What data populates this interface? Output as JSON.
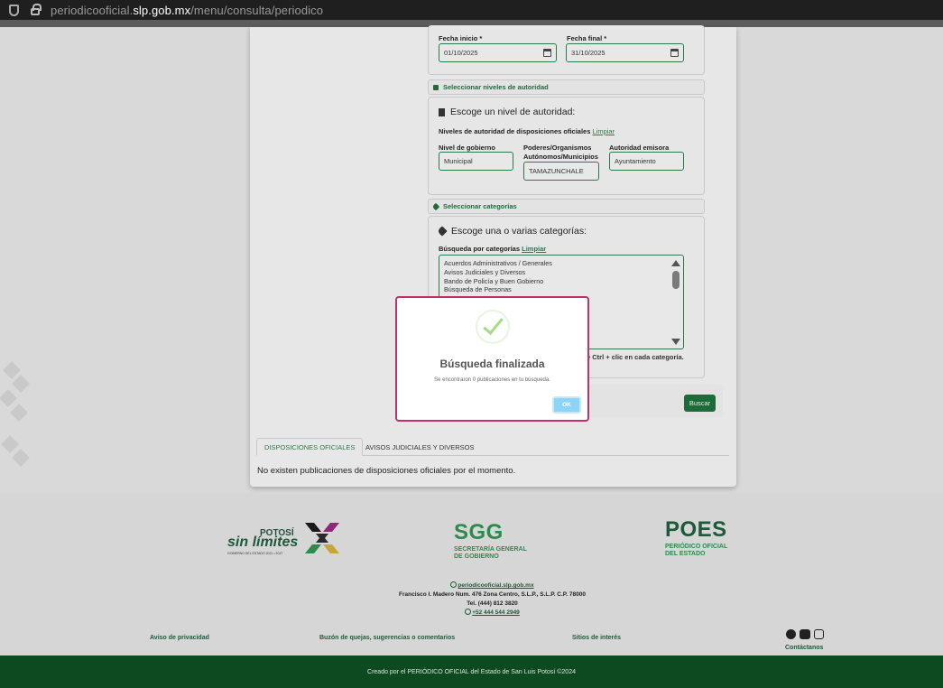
{
  "browser": {
    "url_prefix": "periodicooficial.",
    "url_domain": "slp.gob.mx",
    "url_path": "/menu/consulta/periodico"
  },
  "form": {
    "fecha_inicio_label": "Fecha inicio *",
    "fecha_inicio_value": "01/10/2025",
    "fecha_final_label": "Fecha final *",
    "fecha_final_value": "31/10/2025",
    "niveles_section_title": "Seleccionar niveles de autoridad",
    "niveles_heading": "Escoge un nivel de autoridad:",
    "niveles_sub": "Niveles de autoridad de disposiciones oficiales",
    "limpiar": "Limpiar",
    "nivel_gobierno_label": "Nivel de gobierno",
    "nivel_gobierno_value": "Municipal",
    "poderes_label_1": "Poderes/Organismos",
    "poderes_label_2": "Autónomos/Municipios",
    "poderes_value": "TAMAZUNCHALE",
    "autoridad_label": "Autoridad emisora",
    "autoridad_value": "Ayuntamiento",
    "categorias_section_title": "Seleccionar categorías",
    "categorias_heading": "Escoge una o varias categorías:",
    "categorias_sub": "Búsqueda por categorías",
    "categorias_options": [
      "Acuerdos Administrativos / Generales",
      "Avisos Judiciales y Diversos",
      "Bando de Policía y Buen Gobierno",
      "Búsqueda de Personas"
    ],
    "hint": "e Ctrl + clic en cada categoría.",
    "buscar": "Buscar"
  },
  "results": {
    "tab_disposiciones": "DISPOSICIONES OFICIALES",
    "tab_avisos": "AVISOS JUDICIALES Y DIVERSOS",
    "empty_message": "No existen publicaciones de disposiciones oficiales por el momento."
  },
  "footer": {
    "potosi_line1": "POTOSÍ",
    "potosi_line2": "sin límites",
    "potosi_line3": "GOBIERNO DEL ESTADO 2021 • 2027",
    "sgg_big": "SGG",
    "sgg_small_1": "SECRETARÍA GENERAL",
    "sgg_small_2": "DE GOBIERNO",
    "poes_big": "POES",
    "poes_small_1": "PERIÓDICO OFICIAL",
    "poes_small_2": "DEL ESTADO",
    "website": "periodicooficial.slp.gob.mx",
    "address": "Francisco I. Madero Num. 476 Zona Centro, S.L.P., S.L.P. C.P. 78000",
    "tel": "Tel. (444) 812 3820",
    "whatsapp": "+52 444 544 2949",
    "aviso_privacidad": "Aviso de privacidad",
    "buzon": "Buzón de quejas, sugerencias o comentarios",
    "sitios": "Sitios de interés",
    "contactanos": "Contáctanos",
    "credits": "Creado por el PERIÓDICO OFICIAL del Estado de San Luis Potosí ©2024"
  },
  "modal": {
    "title": "Búsqueda finalizada",
    "text": "Se encontraron 0 publicaciones en tu búsqueda.",
    "ok": "OK"
  }
}
